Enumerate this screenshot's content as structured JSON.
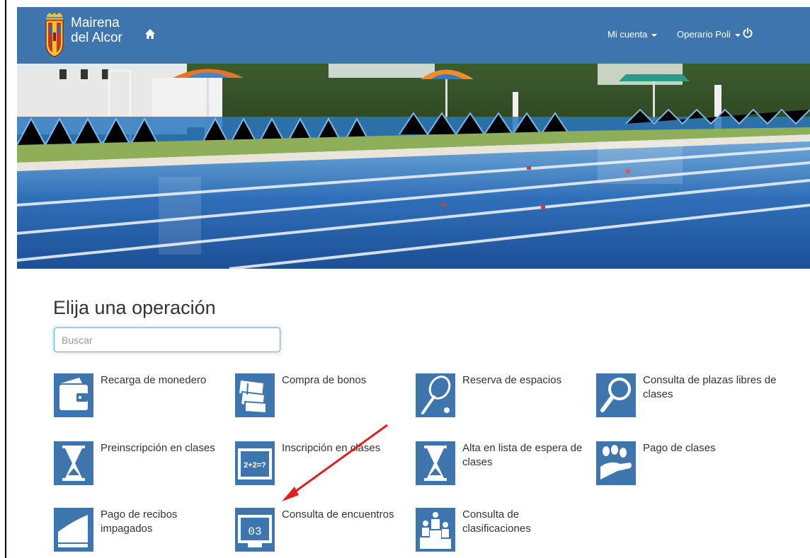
{
  "header": {
    "brand_line1": "Mairena",
    "brand_line2": "del Alcor",
    "account_menu": "Mi cuenta",
    "user_menu": "Operario Poli"
  },
  "main": {
    "title": "Elija una operación",
    "search_placeholder": "Buscar"
  },
  "operations": [
    {
      "label": "Recarga de monedero",
      "icon": "wallet-icon"
    },
    {
      "label": "Compra de bonos",
      "icon": "tickets-icon"
    },
    {
      "label": "Reserva de espacios",
      "icon": "tennis-racket-icon"
    },
    {
      "label": "Consulta de plazas libres de clases",
      "icon": "magnifier-icon"
    },
    {
      "label": "Preinscripción en clases",
      "icon": "hourglass-icon"
    },
    {
      "label": "Inscripción en clases",
      "icon": "blackboard-icon"
    },
    {
      "label": "Alta en lista de espera de clases",
      "icon": "hourglass-icon"
    },
    {
      "label": "Pago de clases",
      "icon": "coins-hand-icon"
    },
    {
      "label": "Pago de recibos impagados",
      "icon": "receipt-icon"
    },
    {
      "label": "Consulta de encuentros",
      "icon": "scoreboard-icon"
    },
    {
      "label": "Consulta de clasificaciones",
      "icon": "podium-icon"
    }
  ],
  "scoreboard_digits": "03",
  "blackboard_text": "2+2=?",
  "colors": {
    "navbar": "#3f75ad",
    "icon_tile": "#3f75ad",
    "annotation_arrow": "#e02020"
  }
}
